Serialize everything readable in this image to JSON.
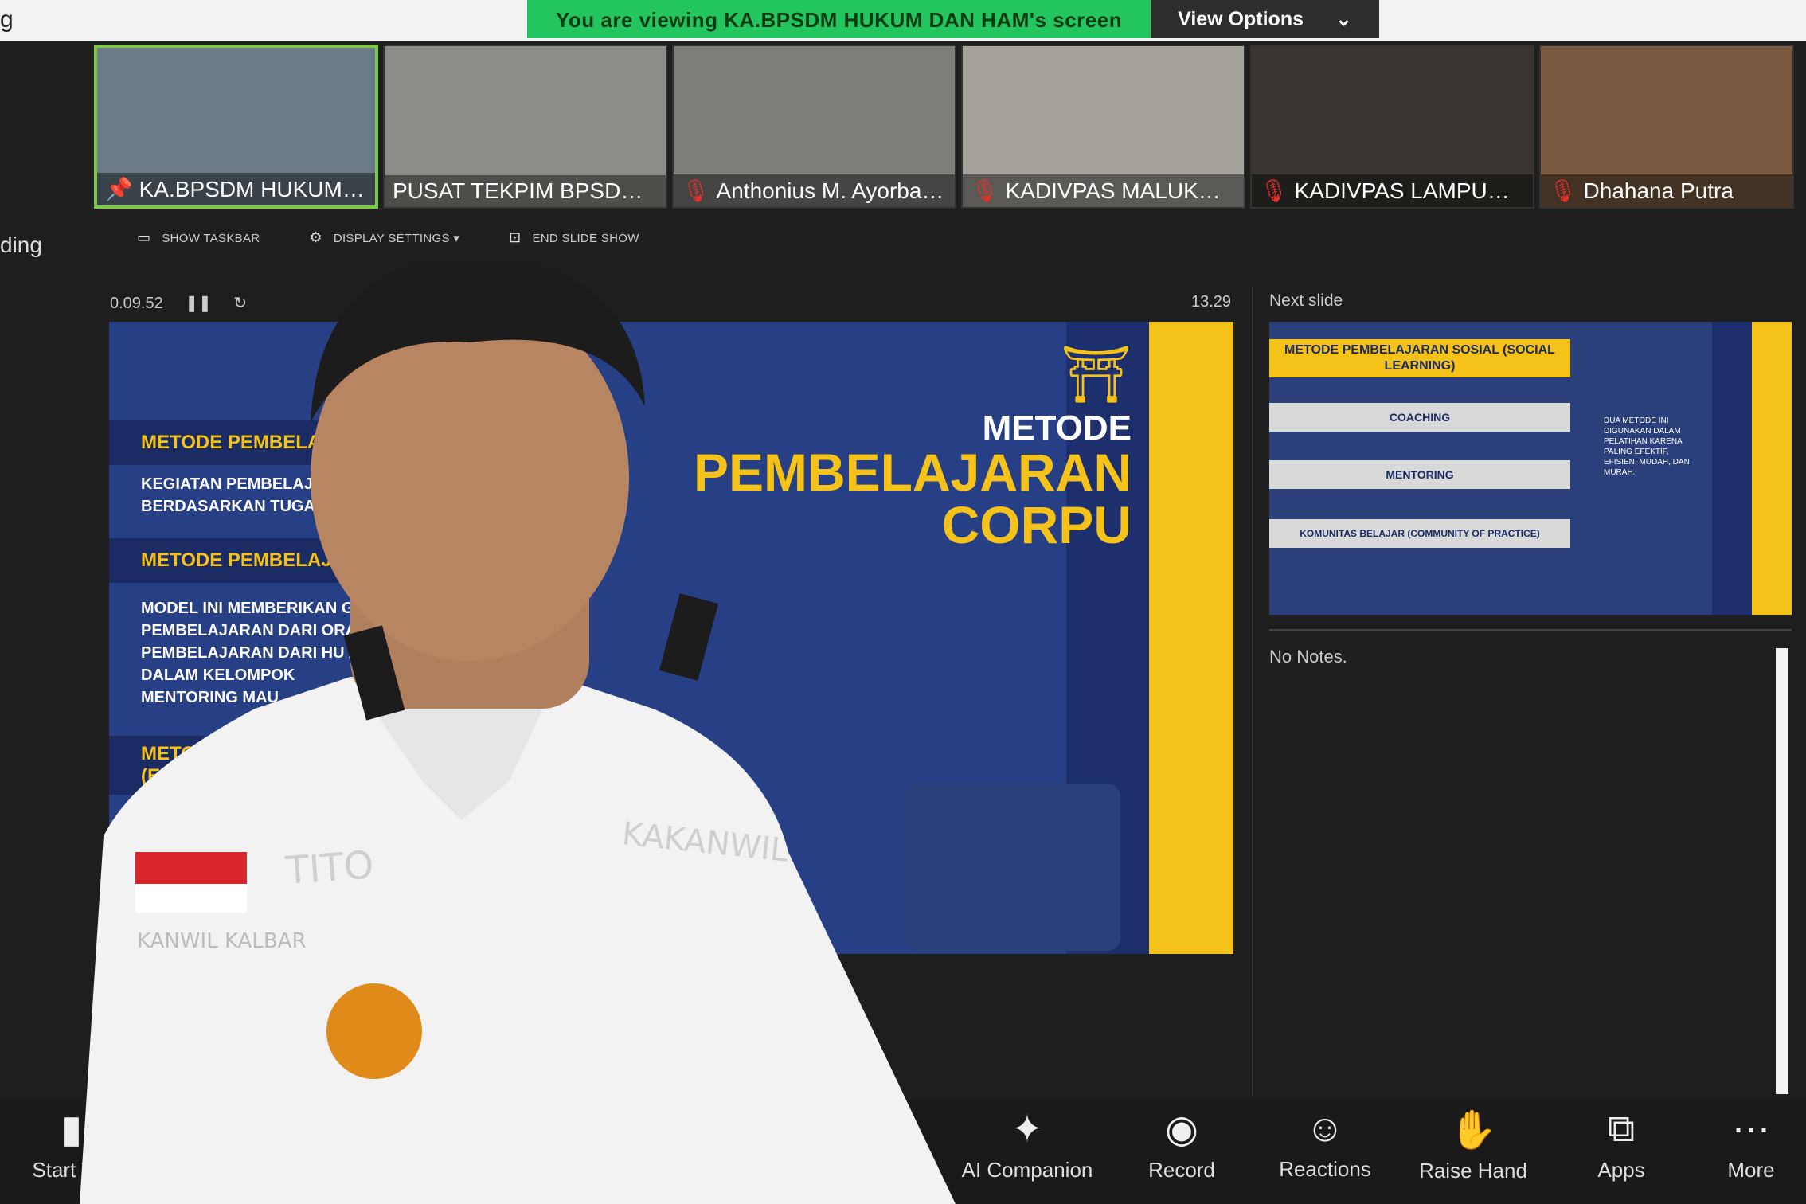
{
  "top": {
    "left_fragment": "g",
    "viewing_message": "You are viewing KA.BPSDM HUKUM DAN HAM's screen",
    "view_options_label": "View Options",
    "chevron_icon": "chevron-down-icon"
  },
  "gallery": [
    {
      "name": "KA.BPSDM HUKUM DA...",
      "muted": false,
      "pinned": true,
      "active": true
    },
    {
      "name": "PUSAT TEKPIM BPSDM H...",
      "muted": false,
      "pinned": false,
      "active": false
    },
    {
      "name": "Anthonius M. Ayorbab...",
      "muted": true,
      "pinned": false,
      "active": false
    },
    {
      "name": "KADIVPAS MALUKU_M...",
      "muted": true,
      "pinned": false,
      "active": false
    },
    {
      "name": "KADIVPAS LAMPUNG ...",
      "muted": true,
      "pinned": false,
      "active": false
    },
    {
      "name": "Dhahana Putra",
      "muted": true,
      "pinned": false,
      "active": false
    }
  ],
  "left_fragment2": "ding",
  "presenter_toolbar": {
    "show_taskbar": "SHOW TASKBAR",
    "display_settings": "DISPLAY SETTINGS ▾",
    "end_slide_show": "END SLIDE SHOW"
  },
  "timer": {
    "elapsed": "0.09.52",
    "clock": "13.29"
  },
  "next_slide_label": "Next slide",
  "current_slide": {
    "title_line1": "METODE",
    "title_line2": "PEMBELAJARAN",
    "title_line3": "CORPU",
    "band1": "METODE PEMBELAJARAN",
    "band2": "METODE PEMBELAJARAN S",
    "band3_a": "METOD",
    "band3_b": "(EXT",
    "body1": "KEGIATAN PEMBELAJARAN  M          PENDIDIKAN",
    "body1b": "BERDASARKAN TUGAS BELAJ",
    "body2": "MODEL INI MEMBERIKAN GA                I KEGIATAN",
    "body2b": "PEMBELAJARAN DARI ORAN                 KEGIATAN",
    "body2c": "PEMBELAJARAN DARI HU                    AJARAN",
    "body2d": "DALAM KELOMPOK",
    "body2e": "MENTORING MAU"
  },
  "next_slide": {
    "header": "METODE PEMBELAJARAN SOSIAL (SOCIAL LEARNING)",
    "row1": "COACHING",
    "row2": "MENTORING",
    "row3": "KOMUNITAS BELAJAR (COMMUNITY OF PRACTICE)",
    "side_text": "DUA METODE INI DIGUNAKAN DALAM PELATIHAN KARENA PALING EFEKTIF, EFISIEN, MUDAH, DAN MURAH."
  },
  "notes_text": "No Notes.",
  "footer": {
    "start_video": "Start Vid",
    "ai_companion": "AI Companion",
    "record": "Record",
    "reactions": "Reactions",
    "raise_hand": "Raise Hand",
    "apps": "Apps",
    "more": "More"
  },
  "overlay_person": {
    "nameplate": "TITO",
    "badge": "KAKANWIL",
    "patch": "KANWIL KALBAR"
  }
}
